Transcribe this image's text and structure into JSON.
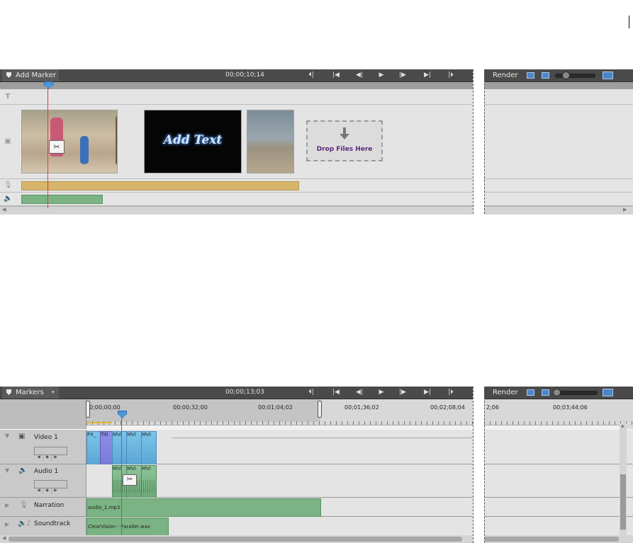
{
  "top_panel": {
    "marker_label": "Add Marker",
    "timecode": "00;00;10;14",
    "transport": [
      "⏮⏴",
      "⏮",
      "⏴⏴",
      "▶",
      "⏵⏵",
      "⏭",
      "⏵⏭"
    ],
    "render_label": "Render",
    "clip_add_text": "Add Text",
    "drop_files": "Drop Files Here"
  },
  "bottom_panel": {
    "marker_label": "Markers",
    "timecode": "00;00;13;03",
    "render_label": "Render",
    "ruler": [
      "0;00;00;00",
      "00;00;32;00",
      "00;01;04;02",
      "00;01;36;02",
      "00;02;08;04",
      "2;06",
      "00;03;44;06"
    ],
    "tracks": [
      {
        "name": "Video 1"
      },
      {
        "name": "Audio 1"
      },
      {
        "name": "Narration"
      },
      {
        "name": "Soundtrack"
      }
    ],
    "video_clips": [
      "PX_",
      "Titl",
      "MVI",
      "MVI",
      "MVI"
    ],
    "audio_clips": [
      "MVI",
      "MVI",
      "MVI"
    ],
    "narration_clip": "audio_1.mp3",
    "soundtrack_clip": "ClearVision - Parallel.wav"
  },
  "colors": {
    "header": "#4a4a4a",
    "track_bg": "#e4e4e4",
    "playhead": "#d94040",
    "narration_bar": "#d7b56a",
    "audio_bar": "#7bb384",
    "accent_blue": "#4c86c9"
  }
}
